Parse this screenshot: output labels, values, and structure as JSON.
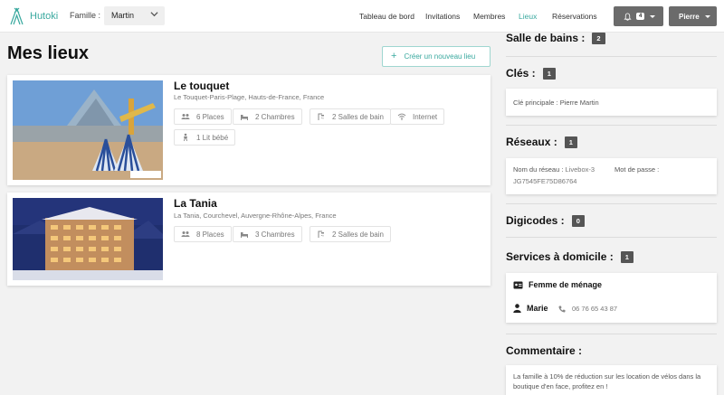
{
  "app": {
    "name": "Hutoki",
    "accent": "#3aa99f"
  },
  "nav": {
    "famille_label": "Famille :",
    "famille_value": "Martin",
    "links": [
      "Tableau de bord",
      "Invitations",
      "Membres",
      "Lieux",
      "Réservations"
    ],
    "active_link": "Lieux",
    "notifications_count": "4",
    "user_name": "Pierre"
  },
  "page": {
    "title": "Mes lieux",
    "create_button": "Créer un nouveau lieu"
  },
  "places": [
    {
      "name": "Le touquet",
      "address": "Le Touquet-Paris-Plage, Hauts-de-France, France",
      "features": [
        {
          "icon": "people-icon",
          "label": "6 Places"
        },
        {
          "icon": "bed-icon",
          "label": "2 Chambres"
        },
        {
          "icon": "shower-icon",
          "label": "2 Salles de bain"
        },
        {
          "icon": "wifi-icon",
          "label": "Internet"
        },
        {
          "icon": "baby-icon",
          "label": "1 Lit bébé"
        }
      ]
    },
    {
      "name": "La Tania",
      "address": "La Tania, Courchevel, Auvergne-Rhône-Alpes, France",
      "features": [
        {
          "icon": "people-icon",
          "label": "8 Places"
        },
        {
          "icon": "bed-icon",
          "label": "3 Chambres"
        },
        {
          "icon": "shower-icon",
          "label": "2 Salles de bain"
        }
      ]
    }
  ],
  "details": {
    "salle_de_bains": {
      "title": "Salle de bains :",
      "count": "2"
    },
    "cles": {
      "title": "Clés :",
      "count": "1",
      "items": [
        "Clé principale : Pierre Martin"
      ]
    },
    "reseaux": {
      "title": "Réseaux :",
      "count": "1",
      "network_label": "Nom du réseau :",
      "network_name": "Livebox-3",
      "password_label": "Mot de passe :",
      "password": "JG7545FE75D86764"
    },
    "digicodes": {
      "title": "Digicodes :",
      "count": "0"
    },
    "services": {
      "title": "Services à domicile :",
      "count": "1",
      "service_name": "Femme de ménage",
      "person": "Marie",
      "phone": "06 76 65 43 87"
    },
    "commentaire": {
      "title": "Commentaire :",
      "text": "La famille à 10% de réduction sur les location de vélos dans la boutique d'en face, profitez en !"
    }
  }
}
